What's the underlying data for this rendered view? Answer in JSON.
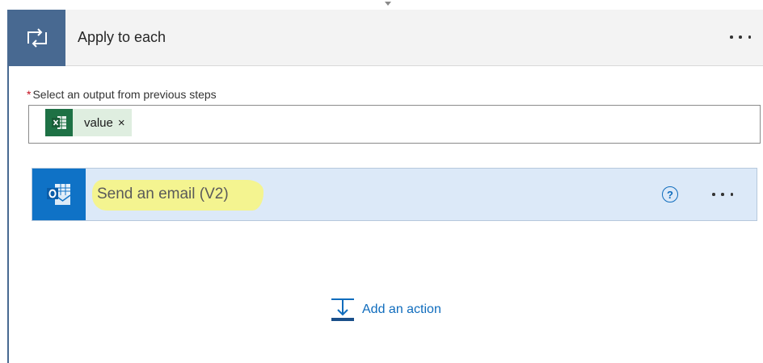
{
  "scope": {
    "title": "Apply to each",
    "icon": "loop-icon",
    "colors": {
      "header_accent": "#486991"
    }
  },
  "field": {
    "required_marker": "*",
    "label": "Select an output from previous steps",
    "token": {
      "label": "value",
      "remove": "×",
      "icon": "excel-icon"
    }
  },
  "action": {
    "title": "Send an email (V2)",
    "icon": "outlook-icon",
    "help": "?",
    "colors": {
      "card_bg": "#dce9f8",
      "icon_bg": "#0f72c6",
      "highlight": "#f4f48a"
    }
  },
  "add_action": {
    "label": "Add an action",
    "icon": "add-action-icon"
  }
}
